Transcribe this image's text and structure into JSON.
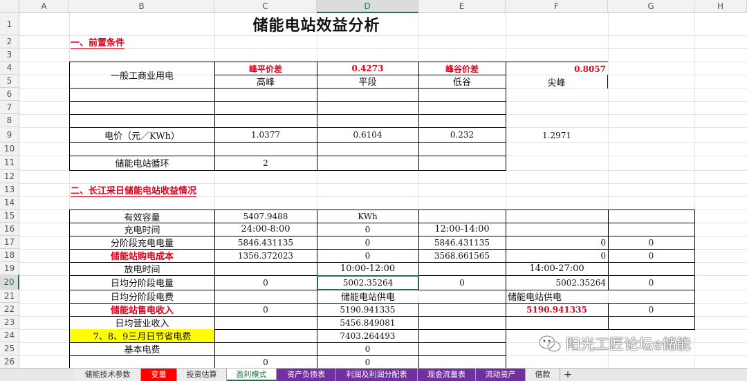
{
  "columns": [
    "A",
    "B",
    "C",
    "D",
    "E",
    "F",
    "G",
    "H"
  ],
  "rows": [
    "1",
    "2",
    "3",
    "4",
    "5",
    "6",
    "7",
    "8",
    "9",
    "10",
    "11",
    "12",
    "13",
    "14",
    "15",
    "16",
    "17",
    "18",
    "19",
    "20",
    "21",
    "22",
    "23",
    "24",
    "25",
    "26"
  ],
  "title": "储能电站效益分析",
  "section1": "一、前置条件",
  "section2": "二、长江采日储能电站收益情况",
  "t1": {
    "type": "一般工商业用电",
    "peak_flat_label": "峰平价差",
    "peak_flat_value": "0.4273",
    "peak_valley_label": "峰谷价差",
    "peak_valley_value": "0.8057",
    "periods": [
      "高峰",
      "平段",
      "低谷",
      "尖峰"
    ],
    "price_label": "电价（元／KWh）",
    "prices": [
      "1.0377",
      "0.6104",
      "0.232",
      "1.2971"
    ],
    "cycle_label": "储能电站循环",
    "cycle_value": "2"
  },
  "t2": {
    "r15": {
      "label": "有效容量",
      "c": "5407.9488",
      "d": "KWh"
    },
    "r16": {
      "label": "充电时间",
      "c": "24:00-8:00",
      "d": "0",
      "e": "12:00-14:00"
    },
    "r17": {
      "label": "分阶段充电电量",
      "c": "5846.431135",
      "d": "0",
      "e": "5846.431135",
      "f": "0",
      "g": "0"
    },
    "r18": {
      "label": "储能站购电成本",
      "c": "1356.372023",
      "d": "0",
      "e": "3568.661565",
      "f": "0",
      "g": "0"
    },
    "r19": {
      "label": "放电时间",
      "d": "10:00-12:00",
      "f": "14:00-27:00"
    },
    "r20": {
      "label": "日均分阶段电量",
      "c": "0",
      "d": "5002.35264",
      "e": "0",
      "f": "5002.35264",
      "g": "0"
    },
    "r21": {
      "label": "日均分阶段电费",
      "d": "储能电站供电",
      "f": "储能电站供电"
    },
    "r22": {
      "label": "储能站售电收入",
      "c": "0",
      "d": "5190.941335",
      "f": "5190.941335",
      "g": "0"
    },
    "r23": {
      "label": "日均营业收入",
      "d": "5456.849081"
    },
    "r24": {
      "label": "7、8、9三月日节省电费",
      "d": "7403.264493"
    },
    "r25": {
      "label": "基本电费",
      "d": "0"
    },
    "r26": {
      "c": "0",
      "d": "0"
    }
  },
  "tabs": [
    "储能技术参数",
    "变量",
    "投资估算",
    "盈利模式",
    "资产负债表",
    "利润及利润分配表",
    "现金流量表",
    "流动资产",
    "借款"
  ],
  "tab_add": "+",
  "watermark": "阳光工匠论坛e储能",
  "colors": {
    "red": "#e0001b",
    "yellow": "#ffff00",
    "selection": "#217346",
    "tab_purple": "#7030a0",
    "tab_red": "#ff0000"
  }
}
